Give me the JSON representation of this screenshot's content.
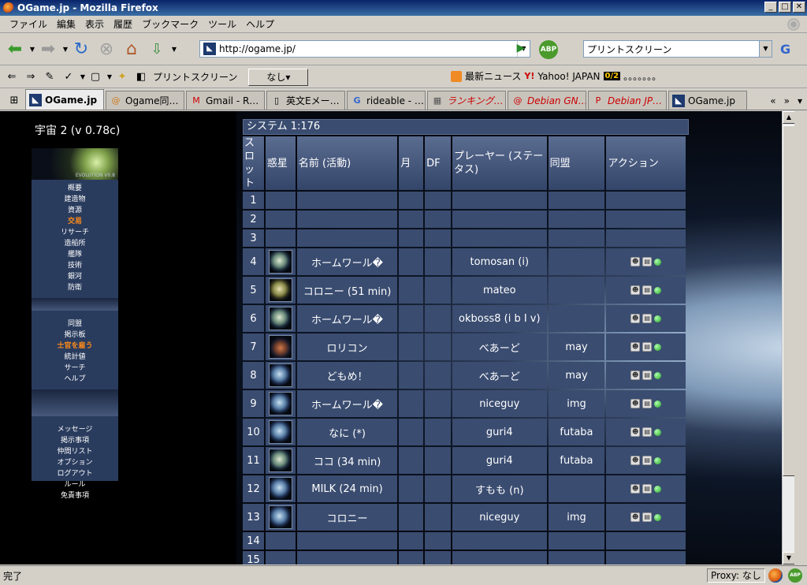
{
  "window": {
    "title": "OGame.jp - Mozilla Firefox",
    "min": "_",
    "max": "□",
    "close": "✕"
  },
  "menubar": [
    "ファイル",
    "編集",
    "表示",
    "履歴",
    "ブックマーク",
    "ツール",
    "ヘルプ"
  ],
  "nav": {
    "url": "http://ogame.jp/",
    "search_value": "プリントスクリーン",
    "abp_label": "ABP",
    "search_engine": "G"
  },
  "bookmarks": {
    "item1": "プリントスクリーン",
    "nashi": "なし▾",
    "news": "最新ニュース",
    "yahoo_label": "Y!",
    "yahoo": "Yahoo! JAPAN",
    "twoch_label": "0/2",
    "twoch_dots": "。。。。。。。"
  },
  "tabs": [
    {
      "label": "OGame.jp",
      "active": true
    },
    {
      "label": "Ogame同…",
      "active": false
    },
    {
      "label": "Gmail - R…",
      "active": false
    },
    {
      "label": "英文Eメー…",
      "active": false
    },
    {
      "label": "rideable - …",
      "active": false
    },
    {
      "label": "ランキング…",
      "active": false,
      "red": true
    },
    {
      "label": "Debian GN…",
      "active": false,
      "red": true
    },
    {
      "label": "Debian JP…",
      "active": false,
      "red": true
    },
    {
      "label": "OGame.jp",
      "active": false
    }
  ],
  "tab_nav": {
    "left": "«",
    "right": "»",
    "list": "▾"
  },
  "game": {
    "galaxy_label": "宇宙 2 (v 0.78c)",
    "banner_text": "EVOLUTION V0.8",
    "menu_group1": [
      "概要",
      "建造物",
      "資源",
      "交易",
      "リサーチ",
      "造船所",
      "艦隊",
      "技術",
      "銀河",
      "防衛"
    ],
    "menu_group2": [
      "同盟",
      "掲示板",
      "士官を雇う",
      "統計値",
      "サーチ",
      "ヘルプ"
    ],
    "menu_group3": [
      "メッセージ",
      "掲示事項",
      "仲間リスト",
      "オプション",
      "ログアウト",
      "ルール",
      "免責事項"
    ],
    "system_title": "システム 1:176",
    "headers": [
      "スロット",
      "惑星",
      "名前 (活動)",
      "月",
      "DF",
      "プレーヤー (ステータス)",
      "同盟",
      "アクション"
    ],
    "rows": [
      {
        "slot": "1",
        "name": "",
        "player": "",
        "alliance": ""
      },
      {
        "slot": "2",
        "name": "",
        "player": "",
        "alliance": ""
      },
      {
        "slot": "3",
        "name": "",
        "player": "",
        "alliance": ""
      },
      {
        "slot": "4",
        "name": "ホームワール�",
        "player": "tomosan (i)",
        "alliance": "",
        "planet": "p1"
      },
      {
        "slot": "5",
        "name": "コロニー (51 min)",
        "player": "mateo",
        "alliance": "",
        "planet": "p2"
      },
      {
        "slot": "6",
        "name": "ホームワール�",
        "player": "okboss8 (i b I v)",
        "alliance": "",
        "planet": "p1",
        "player_color": "blue"
      },
      {
        "slot": "7",
        "name": "ロリコン",
        "player": "べあーど",
        "alliance": "may",
        "planet": "p3"
      },
      {
        "slot": "8",
        "name": "どもめ！",
        "player": "べあーど",
        "alliance": "may",
        "planet": "p4"
      },
      {
        "slot": "9",
        "name": "ホームワール�",
        "player": "niceguy",
        "alliance": "img",
        "planet": "p4"
      },
      {
        "slot": "10",
        "name": "なに (*)",
        "player": "guri4",
        "alliance": "futaba",
        "planet": "p4"
      },
      {
        "slot": "11",
        "name": "ココ (34 min)",
        "player": "guri4",
        "alliance": "futaba",
        "planet": "p1"
      },
      {
        "slot": "12",
        "name": "MILK (24 min)",
        "player": "すもも (n)",
        "alliance": "",
        "planet": "p4",
        "player_color": "green"
      },
      {
        "slot": "13",
        "name": "コロニー",
        "player": "niceguy",
        "alliance": "img",
        "planet": "p4"
      },
      {
        "slot": "14",
        "name": "",
        "player": "",
        "alliance": ""
      },
      {
        "slot": "15",
        "name": "",
        "player": "",
        "alliance": ""
      }
    ]
  },
  "status": {
    "text": "完了",
    "proxy": "Proxy: なし"
  },
  "icons": {
    "back": "back-arrow-icon",
    "forward": "forward-arrow-icon",
    "reload": "reload-icon",
    "stop": "stop-icon",
    "home": "home-icon",
    "go": "go-arrow-icon",
    "rss": "rss-icon"
  }
}
